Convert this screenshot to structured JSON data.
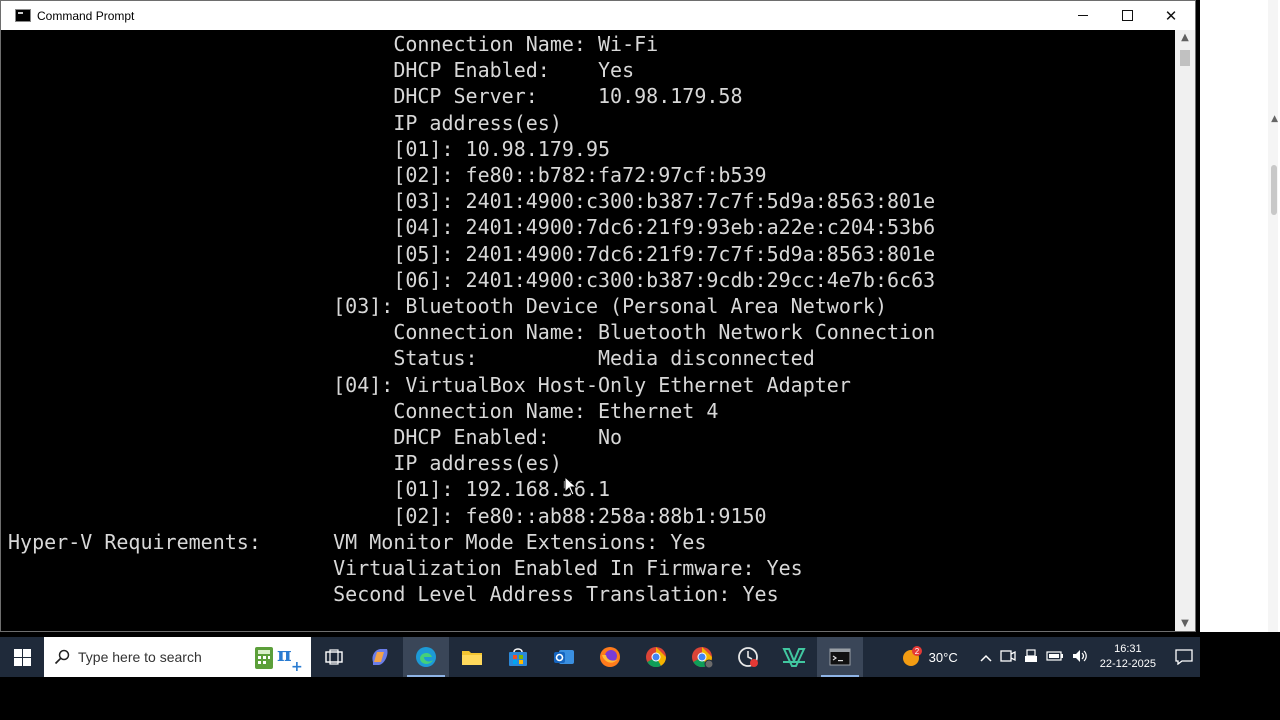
{
  "window": {
    "title": "Command Prompt",
    "controls": {
      "minimize": "—",
      "maximize": "☐",
      "close": "✕"
    }
  },
  "console": {
    "lines": [
      "                                Connection Name: Wi-Fi",
      "                                DHCP Enabled:    Yes",
      "                                DHCP Server:     10.98.179.58",
      "                                IP address(es)",
      "                                [01]: 10.98.179.95",
      "                                [02]: fe80::b782:fa72:97cf:b539",
      "                                [03]: 2401:4900:c300:b387:7c7f:5d9a:8563:801e",
      "                                [04]: 2401:4900:7dc6:21f9:93eb:a22e:c204:53b6",
      "                                [05]: 2401:4900:7dc6:21f9:7c7f:5d9a:8563:801e",
      "                                [06]: 2401:4900:c300:b387:9cdb:29cc:4e7b:6c63",
      "                           [03]: Bluetooth Device (Personal Area Network)",
      "                                Connection Name: Bluetooth Network Connection",
      "                                Status:          Media disconnected",
      "                           [04]: VirtualBox Host-Only Ethernet Adapter",
      "                                Connection Name: Ethernet 4",
      "                                DHCP Enabled:    No",
      "                                IP address(es)",
      "                                [01]: 192.168.56.1",
      "                                [02]: fe80::ab88:258a:88b1:9150",
      "Hyper-V Requirements:      VM Monitor Mode Extensions: Yes",
      "                           Virtualization Enabled In Firmware: Yes",
      "                           Second Level Address Translation: Yes"
    ]
  },
  "taskbar": {
    "search_placeholder": "Type here to search",
    "weather_temp": "30°C",
    "weather_badge": "2",
    "clock_time": "16:31",
    "clock_date": "22-12-2025"
  },
  "colors": {
    "console_bg": "#000000",
    "console_fg": "#d8d8d8",
    "taskbar_bg": "#1f2a3a"
  }
}
